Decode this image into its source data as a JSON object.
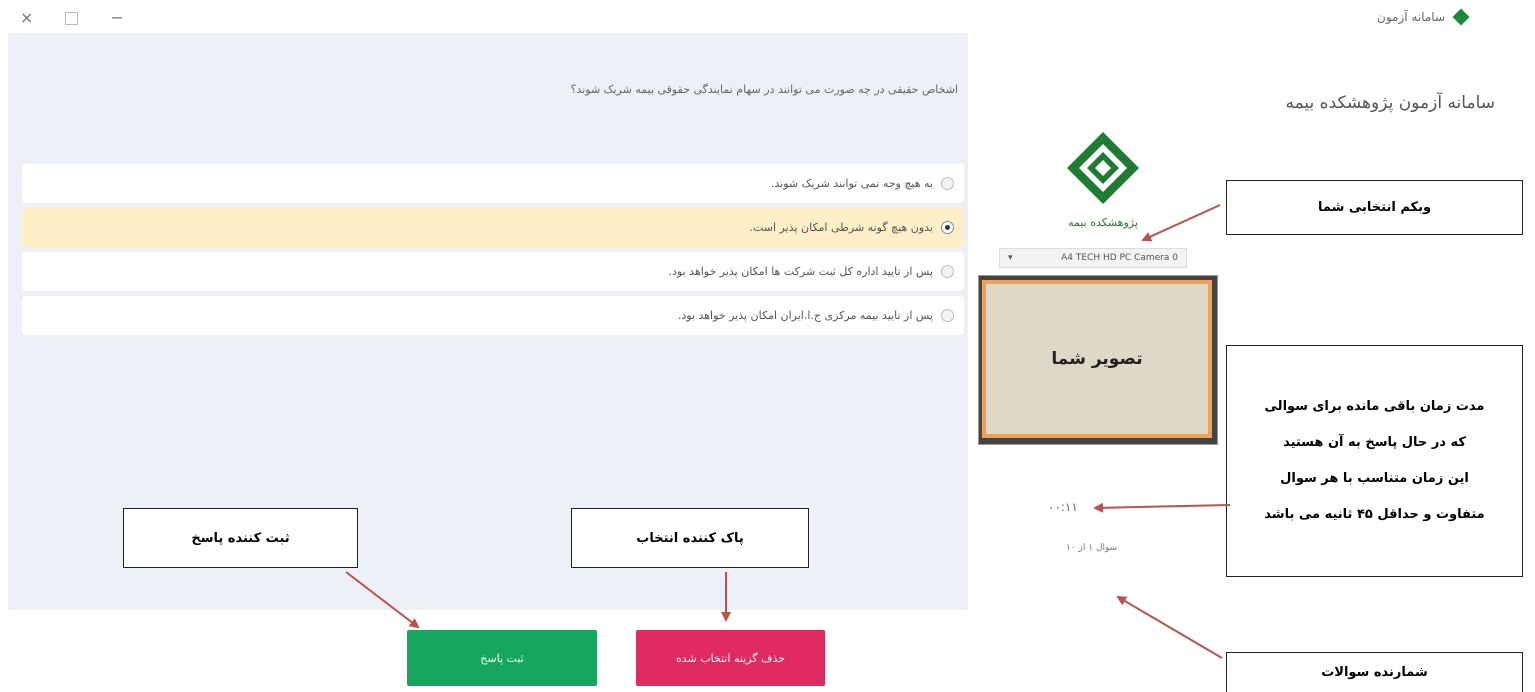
{
  "window": {
    "title": "سامانه آزمون",
    "controls": {
      "close": "×",
      "minimize": "−"
    }
  },
  "question": {
    "text": "اشخاص حقیقی در چه صورت می توانند در سهام نمایندگی حقوقی بیمه شریک شوند؟",
    "options": [
      {
        "label": "به هیچ وجه نمی توانند شریک شوند.",
        "selected": false
      },
      {
        "label": "بدون هیچ گونه شرطی امکان پذیر است.",
        "selected": true
      },
      {
        "label": "پس از تایید اداره کل ثبت شرکت ها امکان پذیر خواهد بود.",
        "selected": false
      },
      {
        "label": "پس از تایید بیمه مرکزی ج.ا.ایران امکان پذیر خواهد بود.",
        "selected": false
      }
    ]
  },
  "sidebar": {
    "system_title": "سامانه آزمون پژوهشکده بیمه",
    "logo_text": "پژوهشکده بیمه",
    "camera_select": "A4 TECH HD PC Camera 0",
    "timer": "۰۰:۱۱",
    "question_counter": "سوال ۱ از ۱۰"
  },
  "buttons": {
    "submit": "ثبت پاسخ",
    "clear": "حذف گزینه انتخاب شده"
  },
  "annotations": {
    "webcam": "وبکم انتخابی شما",
    "your_image": "تصویر شما",
    "time_remaining": [
      "مدت زمان باقی مانده برای سوالی",
      "که در حال پاسخ به آن هستید",
      "این زمان متناسب با هر سوال",
      "متفاوت و حداقل ۴۵ ثانیه می باشد"
    ],
    "question_counter": "شمارنده سوالات",
    "clear_selection": "پاک کننده انتخاب",
    "submit_answer": "ثبت کننده پاسخ"
  },
  "colors": {
    "panel_bg": "#edf0f7",
    "selected_option_bg": "#fdf0c8",
    "submit_button": "#17a65d",
    "clear_button": "#e02a62",
    "camera_preview_bg": "#ddd9c6",
    "camera_preview_border": "#f0a055",
    "arrow": "#c0504d"
  }
}
